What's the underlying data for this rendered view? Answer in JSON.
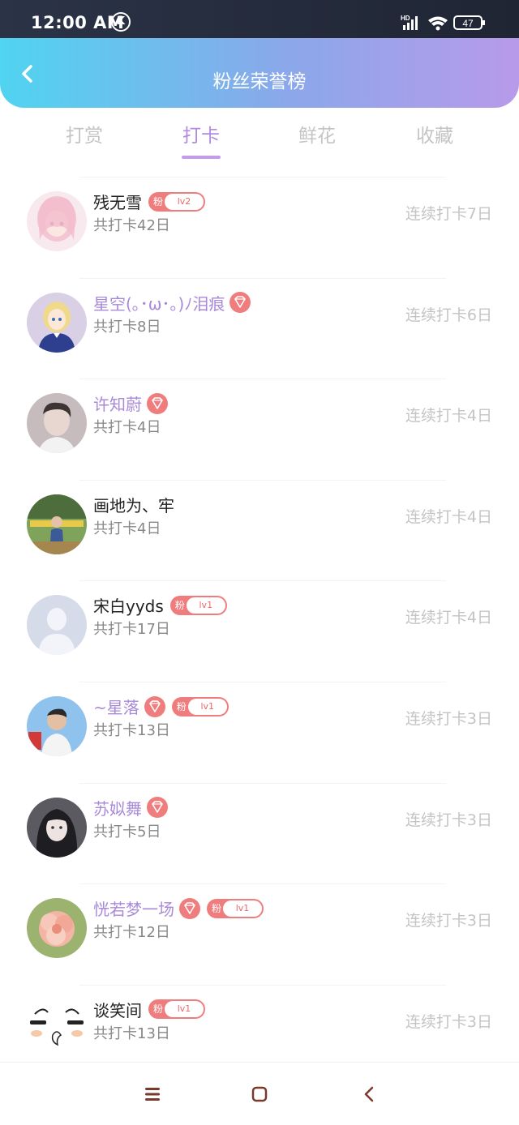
{
  "status": {
    "time": "12:00 AM",
    "k_label": "K",
    "battery": "47",
    "network_label": "HD"
  },
  "header": {
    "title": "粉丝荣誉榜"
  },
  "tabs": [
    {
      "label": "打赏",
      "active": false
    },
    {
      "label": "打卡",
      "active": true
    },
    {
      "label": "鲜花",
      "active": false
    },
    {
      "label": "收藏",
      "active": false
    }
  ],
  "badge_fan_label": "粉",
  "list": [
    {
      "name": "残无雪",
      "name_color": "black",
      "diamond": false,
      "fan_level": "lv2",
      "total": "共打卡42日",
      "streak": "连续打卡7日",
      "avatar": "anime-pink-hair"
    },
    {
      "name": "星空(｡･ω･｡)ﾉ泪痕",
      "name_color": "purple",
      "diamond": true,
      "fan_level": null,
      "total": "共打卡8日",
      "streak": "连续打卡6日",
      "avatar": "anime-blonde-knight"
    },
    {
      "name": "许知蔚",
      "name_color": "purple",
      "diamond": true,
      "fan_level": null,
      "total": "共打卡4日",
      "streak": "连续打卡4日",
      "avatar": "person-portrait"
    },
    {
      "name": "画地为、牢",
      "name_color": "black",
      "diamond": false,
      "fan_level": null,
      "total": "共打卡4日",
      "streak": "连续打卡4日",
      "avatar": "person-outdoor"
    },
    {
      "name": "宋白yyds",
      "name_color": "black",
      "diamond": false,
      "fan_level": "lv1",
      "total": "共打卡17日",
      "streak": "连续打卡4日",
      "avatar": "default-silhouette"
    },
    {
      "name": "~星落",
      "name_color": "purple",
      "diamond": true,
      "fan_level": "lv1",
      "total": "共打卡13日",
      "streak": "连续打卡3日",
      "avatar": "person-blue-bg"
    },
    {
      "name": "苏姒舞",
      "name_color": "purple",
      "diamond": true,
      "fan_level": null,
      "total": "共打卡5日",
      "streak": "连续打卡3日",
      "avatar": "girl-dark-hair"
    },
    {
      "name": "恍若梦一场",
      "name_color": "purple",
      "diamond": true,
      "fan_level": "lv1",
      "total": "共打卡12日",
      "streak": "连续打卡3日",
      "avatar": "pink-flower"
    },
    {
      "name": "谈笑间",
      "name_color": "black",
      "diamond": false,
      "fan_level": "lv1",
      "total": "共打卡13日",
      "streak": "连续打卡3日",
      "avatar": "cartoon-face"
    }
  ],
  "colors": {
    "accent": "#b18be0",
    "badge_red": "#f07d7d",
    "header_start": "#50d4f0",
    "header_end": "#b89aea"
  }
}
